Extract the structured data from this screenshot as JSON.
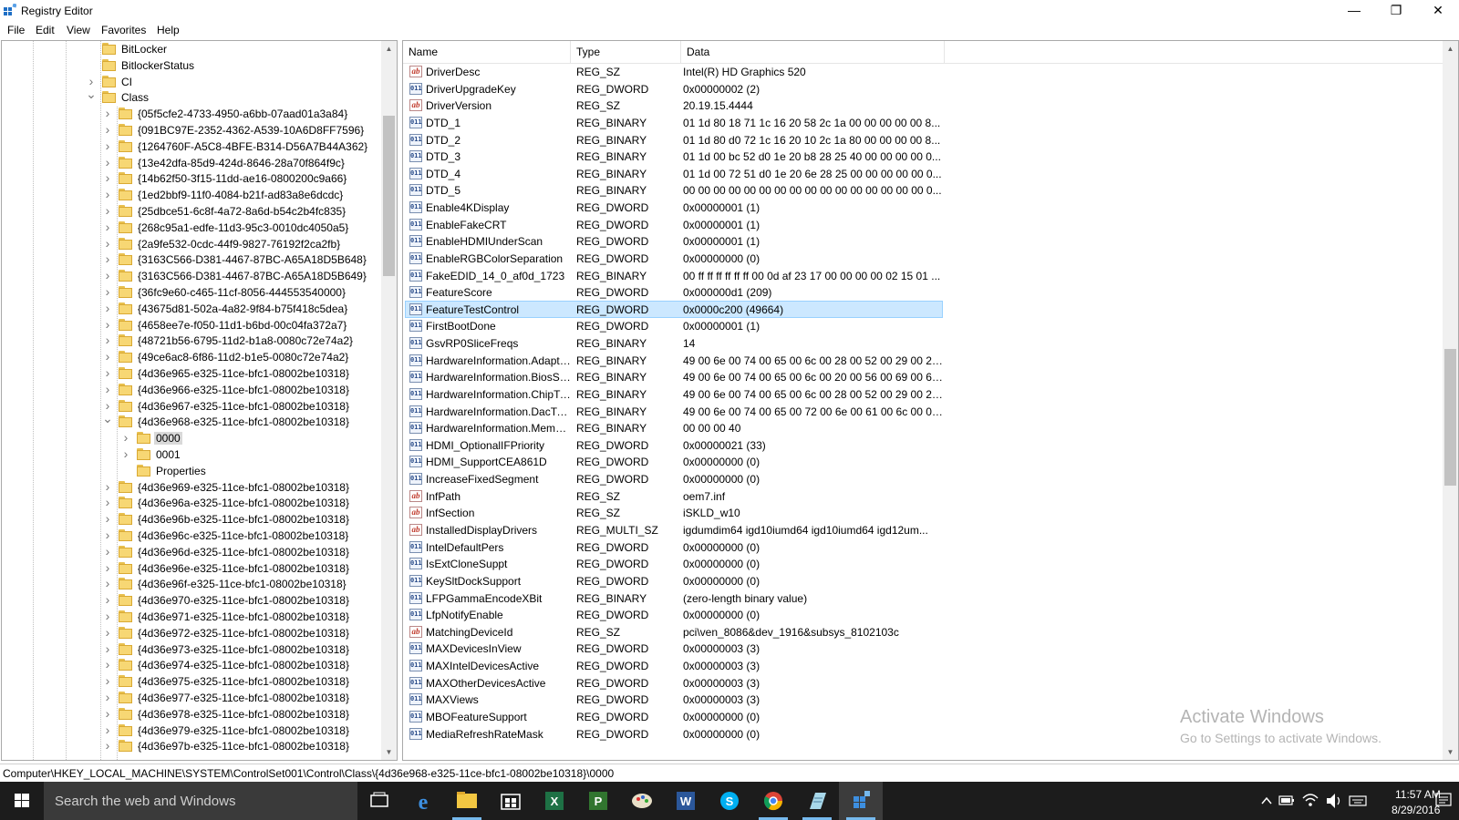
{
  "window": {
    "title": "Registry Editor",
    "minimize_glyph": "—",
    "maximize_glyph": "❐",
    "close_glyph": "✕"
  },
  "menu": [
    "File",
    "Edit",
    "View",
    "Favorites",
    "Help"
  ],
  "tree": {
    "nodes": [
      {
        "label": "BitLocker",
        "level": 0,
        "expander": "none"
      },
      {
        "label": "BitlockerStatus",
        "level": 0,
        "expander": "none"
      },
      {
        "label": "CI",
        "level": 0,
        "expander": "collapsed"
      },
      {
        "label": "Class",
        "level": 0,
        "expander": "expanded"
      },
      {
        "label": "{05f5cfe2-4733-4950-a6bb-07aad01a3a84}",
        "level": 1,
        "expander": "collapsed"
      },
      {
        "label": "{091BC97E-2352-4362-A539-10A6D8FF7596}",
        "level": 1,
        "expander": "collapsed"
      },
      {
        "label": "{1264760F-A5C8-4BFE-B314-D56A7B44A362}",
        "level": 1,
        "expander": "collapsed"
      },
      {
        "label": "{13e42dfa-85d9-424d-8646-28a70f864f9c}",
        "level": 1,
        "expander": "collapsed"
      },
      {
        "label": "{14b62f50-3f15-11dd-ae16-0800200c9a66}",
        "level": 1,
        "expander": "collapsed"
      },
      {
        "label": "{1ed2bbf9-11f0-4084-b21f-ad83a8e6dcdc}",
        "level": 1,
        "expander": "collapsed"
      },
      {
        "label": "{25dbce51-6c8f-4a72-8a6d-b54c2b4fc835}",
        "level": 1,
        "expander": "collapsed"
      },
      {
        "label": "{268c95a1-edfe-11d3-95c3-0010dc4050a5}",
        "level": 1,
        "expander": "collapsed"
      },
      {
        "label": "{2a9fe532-0cdc-44f9-9827-76192f2ca2fb}",
        "level": 1,
        "expander": "collapsed"
      },
      {
        "label": "{3163C566-D381-4467-87BC-A65A18D5B648}",
        "level": 1,
        "expander": "collapsed"
      },
      {
        "label": "{3163C566-D381-4467-87BC-A65A18D5B649}",
        "level": 1,
        "expander": "collapsed"
      },
      {
        "label": "{36fc9e60-c465-11cf-8056-444553540000}",
        "level": 1,
        "expander": "collapsed"
      },
      {
        "label": "{43675d81-502a-4a82-9f84-b75f418c5dea}",
        "level": 1,
        "expander": "collapsed"
      },
      {
        "label": "{4658ee7e-f050-11d1-b6bd-00c04fa372a7}",
        "level": 1,
        "expander": "collapsed"
      },
      {
        "label": "{48721b56-6795-11d2-b1a8-0080c72e74a2}",
        "level": 1,
        "expander": "collapsed"
      },
      {
        "label": "{49ce6ac8-6f86-11d2-b1e5-0080c72e74a2}",
        "level": 1,
        "expander": "collapsed"
      },
      {
        "label": "{4d36e965-e325-11ce-bfc1-08002be10318}",
        "level": 1,
        "expander": "collapsed"
      },
      {
        "label": "{4d36e966-e325-11ce-bfc1-08002be10318}",
        "level": 1,
        "expander": "collapsed"
      },
      {
        "label": "{4d36e967-e325-11ce-bfc1-08002be10318}",
        "level": 1,
        "expander": "collapsed"
      },
      {
        "label": "{4d36e968-e325-11ce-bfc1-08002be10318}",
        "level": 1,
        "expander": "expanded"
      },
      {
        "label": "0000",
        "level": 2,
        "expander": "collapsed",
        "selected": true
      },
      {
        "label": "0001",
        "level": 2,
        "expander": "collapsed"
      },
      {
        "label": "Properties",
        "level": 2,
        "expander": "none"
      },
      {
        "label": "{4d36e969-e325-11ce-bfc1-08002be10318}",
        "level": 1,
        "expander": "collapsed"
      },
      {
        "label": "{4d36e96a-e325-11ce-bfc1-08002be10318}",
        "level": 1,
        "expander": "collapsed"
      },
      {
        "label": "{4d36e96b-e325-11ce-bfc1-08002be10318}",
        "level": 1,
        "expander": "collapsed"
      },
      {
        "label": "{4d36e96c-e325-11ce-bfc1-08002be10318}",
        "level": 1,
        "expander": "collapsed"
      },
      {
        "label": "{4d36e96d-e325-11ce-bfc1-08002be10318}",
        "level": 1,
        "expander": "collapsed"
      },
      {
        "label": "{4d36e96e-e325-11ce-bfc1-08002be10318}",
        "level": 1,
        "expander": "collapsed"
      },
      {
        "label": "{4d36e96f-e325-11ce-bfc1-08002be10318}",
        "level": 1,
        "expander": "collapsed"
      },
      {
        "label": "{4d36e970-e325-11ce-bfc1-08002be10318}",
        "level": 1,
        "expander": "collapsed"
      },
      {
        "label": "{4d36e971-e325-11ce-bfc1-08002be10318}",
        "level": 1,
        "expander": "collapsed"
      },
      {
        "label": "{4d36e972-e325-11ce-bfc1-08002be10318}",
        "level": 1,
        "expander": "collapsed"
      },
      {
        "label": "{4d36e973-e325-11ce-bfc1-08002be10318}",
        "level": 1,
        "expander": "collapsed"
      },
      {
        "label": "{4d36e974-e325-11ce-bfc1-08002be10318}",
        "level": 1,
        "expander": "collapsed"
      },
      {
        "label": "{4d36e975-e325-11ce-bfc1-08002be10318}",
        "level": 1,
        "expander": "collapsed"
      },
      {
        "label": "{4d36e977-e325-11ce-bfc1-08002be10318}",
        "level": 1,
        "expander": "collapsed"
      },
      {
        "label": "{4d36e978-e325-11ce-bfc1-08002be10318}",
        "level": 1,
        "expander": "collapsed"
      },
      {
        "label": "{4d36e979-e325-11ce-bfc1-08002be10318}",
        "level": 1,
        "expander": "collapsed"
      },
      {
        "label": "{4d36e97b-e325-11ce-bfc1-08002be10318}",
        "level": 1,
        "expander": "collapsed"
      }
    ]
  },
  "values": {
    "columns": [
      "Name",
      "Type",
      "Data"
    ],
    "rows": [
      {
        "name": "DriverDesc",
        "type": "REG_SZ",
        "data": "Intel(R) HD Graphics 520",
        "kind": "sz"
      },
      {
        "name": "DriverUpgradeKey",
        "type": "REG_DWORD",
        "data": "0x00000002 (2)",
        "kind": "bin"
      },
      {
        "name": "DriverVersion",
        "type": "REG_SZ",
        "data": "20.19.15.4444",
        "kind": "sz"
      },
      {
        "name": "DTD_1",
        "type": "REG_BINARY",
        "data": "01 1d 80 18 71 1c 16 20 58 2c 1a 00 00 00 00 00 8...",
        "kind": "bin"
      },
      {
        "name": "DTD_2",
        "type": "REG_BINARY",
        "data": "01 1d 80 d0 72 1c 16 20 10 2c 1a 80 00 00 00 00 8...",
        "kind": "bin"
      },
      {
        "name": "DTD_3",
        "type": "REG_BINARY",
        "data": "01 1d 00 bc 52 d0 1e 20 b8 28 25 40 00 00 00 00 0...",
        "kind": "bin"
      },
      {
        "name": "DTD_4",
        "type": "REG_BINARY",
        "data": "01 1d 00 72 51 d0 1e 20 6e 28 25 00 00 00 00 00 0...",
        "kind": "bin"
      },
      {
        "name": "DTD_5",
        "type": "REG_BINARY",
        "data": "00 00 00 00 00 00 00 00 00 00 00 00 00 00 00 00 0...",
        "kind": "bin"
      },
      {
        "name": "Enable4KDisplay",
        "type": "REG_DWORD",
        "data": "0x00000001 (1)",
        "kind": "bin"
      },
      {
        "name": "EnableFakeCRT",
        "type": "REG_DWORD",
        "data": "0x00000001 (1)",
        "kind": "bin"
      },
      {
        "name": "EnableHDMIUnderScan",
        "type": "REG_DWORD",
        "data": "0x00000001 (1)",
        "kind": "bin"
      },
      {
        "name": "EnableRGBColorSeparation",
        "type": "REG_DWORD",
        "data": "0x00000000 (0)",
        "kind": "bin"
      },
      {
        "name": "FakeEDID_14_0_af0d_1723",
        "type": "REG_BINARY",
        "data": "00 ff ff ff ff ff ff 00 0d af 23 17 00 00 00 00 02 15 01 ...",
        "kind": "bin"
      },
      {
        "name": "FeatureScore",
        "type": "REG_DWORD",
        "data": "0x000000d1 (209)",
        "kind": "bin"
      },
      {
        "name": "FeatureTestControl",
        "type": "REG_DWORD",
        "data": "0x0000c200 (49664)",
        "kind": "bin",
        "selected": true
      },
      {
        "name": "FirstBootDone",
        "type": "REG_DWORD",
        "data": "0x00000001 (1)",
        "kind": "bin"
      },
      {
        "name": "GsvRP0SliceFreqs",
        "type": "REG_BINARY",
        "data": "14",
        "kind": "bin"
      },
      {
        "name": "HardwareInformation.AdapterString",
        "type": "REG_BINARY",
        "data": "49 00 6e 00 74 00 65 00 6c 00 28 00 52 00 29 00 20 0...",
        "kind": "bin"
      },
      {
        "name": "HardwareInformation.BiosString",
        "type": "REG_BINARY",
        "data": "49 00 6e 00 74 00 65 00 6c 00 20 00 56 00 69 00 64 0...",
        "kind": "bin"
      },
      {
        "name": "HardwareInformation.ChipType",
        "type": "REG_BINARY",
        "data": "49 00 6e 00 74 00 65 00 6c 00 28 00 52 00 29 00 20 0...",
        "kind": "bin"
      },
      {
        "name": "HardwareInformation.DacType",
        "type": "REG_BINARY",
        "data": "49 00 6e 00 74 00 65 00 72 00 6e 00 61 00 6c 00 00 00",
        "kind": "bin"
      },
      {
        "name": "HardwareInformation.MemorySize",
        "type": "REG_BINARY",
        "data": "00 00 00 40",
        "kind": "bin"
      },
      {
        "name": "HDMI_OptionalIFPriority",
        "type": "REG_DWORD",
        "data": "0x00000021 (33)",
        "kind": "bin"
      },
      {
        "name": "HDMI_SupportCEA861D",
        "type": "REG_DWORD",
        "data": "0x00000000 (0)",
        "kind": "bin"
      },
      {
        "name": "IncreaseFixedSegment",
        "type": "REG_DWORD",
        "data": "0x00000000 (0)",
        "kind": "bin"
      },
      {
        "name": "InfPath",
        "type": "REG_SZ",
        "data": "oem7.inf",
        "kind": "sz"
      },
      {
        "name": "InfSection",
        "type": "REG_SZ",
        "data": "iSKLD_w10",
        "kind": "sz"
      },
      {
        "name": "InstalledDisplayDrivers",
        "type": "REG_MULTI_SZ",
        "data": "igdumdim64 igd10iumd64 igd10iumd64 igd12um...",
        "kind": "sz"
      },
      {
        "name": "IntelDefaultPers",
        "type": "REG_DWORD",
        "data": "0x00000000 (0)",
        "kind": "bin"
      },
      {
        "name": "IsExtCloneSuppt",
        "type": "REG_DWORD",
        "data": "0x00000000 (0)",
        "kind": "bin"
      },
      {
        "name": "KeySltDockSupport",
        "type": "REG_DWORD",
        "data": "0x00000000 (0)",
        "kind": "bin"
      },
      {
        "name": "LFPGammaEncodeXBit",
        "type": "REG_BINARY",
        "data": "(zero-length binary value)",
        "kind": "bin"
      },
      {
        "name": "LfpNotifyEnable",
        "type": "REG_DWORD",
        "data": "0x00000000 (0)",
        "kind": "bin"
      },
      {
        "name": "MatchingDeviceId",
        "type": "REG_SZ",
        "data": "pci\\ven_8086&dev_1916&subsys_8102103c",
        "kind": "sz"
      },
      {
        "name": "MAXDevicesInView",
        "type": "REG_DWORD",
        "data": "0x00000003 (3)",
        "kind": "bin"
      },
      {
        "name": "MAXIntelDevicesActive",
        "type": "REG_DWORD",
        "data": "0x00000003 (3)",
        "kind": "bin"
      },
      {
        "name": "MAXOtherDevicesActive",
        "type": "REG_DWORD",
        "data": "0x00000003 (3)",
        "kind": "bin"
      },
      {
        "name": "MAXViews",
        "type": "REG_DWORD",
        "data": "0x00000003 (3)",
        "kind": "bin"
      },
      {
        "name": "MBOFeatureSupport",
        "type": "REG_DWORD",
        "data": "0x00000000 (0)",
        "kind": "bin"
      },
      {
        "name": "MediaRefreshRateMask",
        "type": "REG_DWORD",
        "data": "0x00000000 (0)",
        "kind": "bin"
      }
    ]
  },
  "watermark": {
    "line1": "Activate Windows",
    "line2": "Go to Settings to activate Windows."
  },
  "status": {
    "path": "Computer\\HKEY_LOCAL_MACHINE\\SYSTEM\\ControlSet001\\Control\\Class\\{4d36e968-e325-11ce-bfc1-08002be10318}\\0000"
  },
  "taskbar": {
    "search_placeholder": "Search the web and Windows",
    "apps": [
      {
        "name": "task-view-icon"
      },
      {
        "name": "edge-icon"
      },
      {
        "name": "file-explorer-icon"
      },
      {
        "name": "store-icon"
      },
      {
        "name": "excel-icon"
      },
      {
        "name": "project-icon"
      },
      {
        "name": "paint-icon"
      },
      {
        "name": "word-icon"
      },
      {
        "name": "skype-icon"
      },
      {
        "name": "chrome-icon"
      },
      {
        "name": "notepad-icon"
      },
      {
        "name": "regedit-icon"
      }
    ],
    "clock_time": "11:57 AM",
    "clock_date": "8/29/2016"
  },
  "colors": {
    "selection": "#cce8ff",
    "selection_border": "#99d1ff",
    "folder": "#f7d774",
    "taskbar": "#1c1c1c",
    "taskbar_accent": "#76b9ed"
  }
}
